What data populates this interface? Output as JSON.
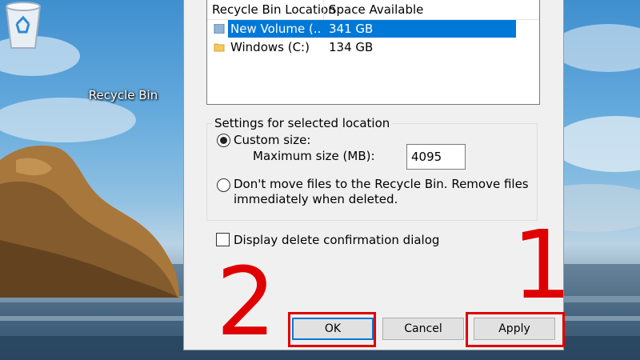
{
  "desktop": {
    "recycle_bin_label": "Recycle Bin"
  },
  "dialog": {
    "list": {
      "col_location": "Recycle Bin Location",
      "col_space": "Space Available",
      "rows": [
        {
          "name": "New Volume (...",
          "space": "341 GB",
          "selected": true
        },
        {
          "name": "Windows (C:)",
          "space": "134 GB",
          "selected": false
        }
      ]
    },
    "settings_group_title": "Settings for selected location",
    "custom_size_label": "Custom size:",
    "max_size_label": "Maximum size (MB):",
    "max_size_value": "4095",
    "dont_move_line1": "Don't move files to the Recycle Bin. Remove files",
    "dont_move_line2": "immediately when deleted.",
    "confirm_dialog_label": "Display delete confirmation dialog",
    "buttons": {
      "ok": "OK",
      "cancel": "Cancel",
      "apply": "Apply"
    }
  },
  "annotations": {
    "num_1": "1",
    "num_2": "2",
    "color": "#e00000"
  },
  "colors": {
    "selection": "#0078d7",
    "dialog_bg": "#f0f0f0"
  }
}
